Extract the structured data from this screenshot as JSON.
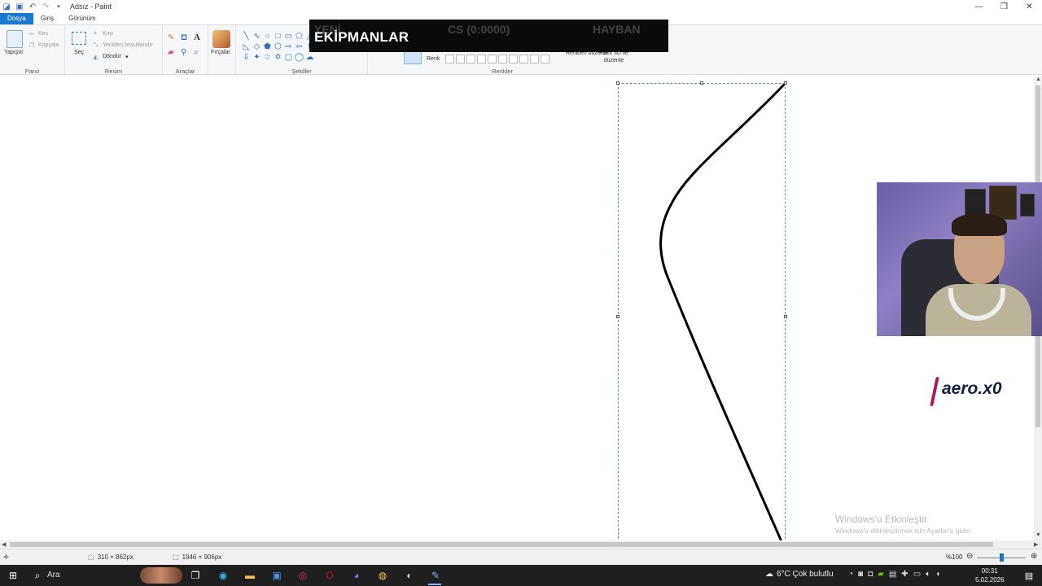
{
  "window": {
    "title": "Adsız - Paint",
    "controls": {
      "minimize": "—",
      "maximize": "❐",
      "close": "✕"
    }
  },
  "tabs": [
    {
      "label": "Dosya",
      "active": true
    },
    {
      "label": "Giriş",
      "active": false
    },
    {
      "label": "Görünüm",
      "active": false
    }
  ],
  "ribbon": {
    "pano": {
      "label": "Pano",
      "paste": "Yapıştır",
      "cut": "Kes",
      "copy": "Kopyala"
    },
    "resim": {
      "label": "Resim",
      "select": "Seç",
      "crop": "Kırp",
      "resize": "Yeniden boyutlandır",
      "rotate": "Döndür"
    },
    "araclar": {
      "label": "Araçlar"
    },
    "brushes": {
      "label": "Fırçalar"
    },
    "sekiller": {
      "label": "Şekiller"
    },
    "renkler": {
      "label": "Renkler",
      "color": "Renk",
      "edit_colors": "Renkleri düzenle",
      "paint3d": "Paint 3D ile düzenle"
    }
  },
  "overlay": {
    "title": "EKİPMANLAR",
    "ghost_text": [
      "YENİ",
      "CS (0:0000)",
      "HAYBAN"
    ]
  },
  "canvas": {
    "accent_selection": "#5a8fa8",
    "stroke_color": "#000000"
  },
  "webcam_brand": "aero.x0",
  "activation": {
    "title": "Windows'u Etkinleştir",
    "subtitle": "Windows'u etkinleştirmek için Ayarlar'a gidin."
  },
  "status": {
    "selection_size": "310 × 862px",
    "image_size": "1946 × 906px",
    "zoom": "%100"
  },
  "taskbar": {
    "search": "Ara",
    "weather": "6°C  Çok bulutlu",
    "time": "00:31",
    "date": "5.02.2026"
  }
}
